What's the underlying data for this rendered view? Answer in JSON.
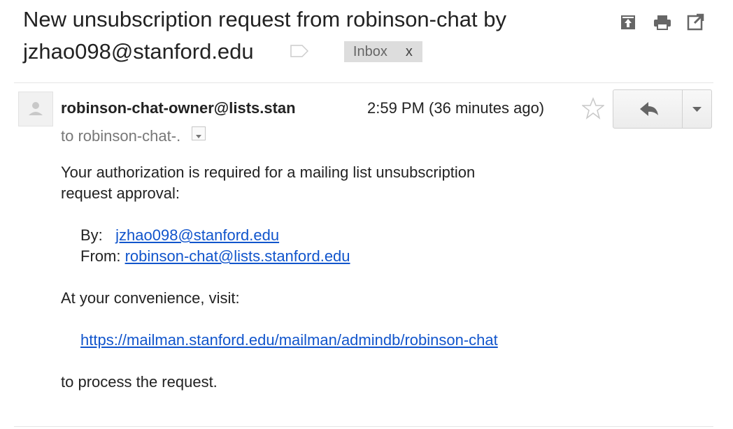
{
  "subject": {
    "text": "New unsubscription request from robinson-chat by jzhao098@stanford.edu",
    "label_icon": "label-icon",
    "inbox_label": "Inbox",
    "inbox_remove": "x"
  },
  "toolbar": {
    "icons": [
      "open-in-new-window-icon",
      "print-icon",
      "pop-out-icon"
    ]
  },
  "message": {
    "avatar_icon": "default-avatar-icon",
    "sender": "robinson-chat-owner@lists.stan",
    "time": "2:59 PM (36 minutes ago)",
    "star_icon": "star-icon",
    "reply_icon": "reply-icon",
    "more_icon": "chevron-down-icon",
    "to_line": "to robinson-chat-.",
    "body": {
      "line1": "Your authorization is required for a mailing list unsubscription",
      "line2": "request approval:",
      "by_label": "By:",
      "by_value": "jzhao098@stanford.edu",
      "from_label": "From:",
      "from_value": "robinson-chat@lists.stanford.edu",
      "visit_line": "At your convenience, visit:",
      "admin_link": "https://mailman.stanford.edu/mailman/admindb/robinson-chat",
      "closing": "to process the request."
    }
  },
  "colors": {
    "link": "#1155cc",
    "chip_bg": "#dddddd",
    "muted_text": "#777777"
  }
}
